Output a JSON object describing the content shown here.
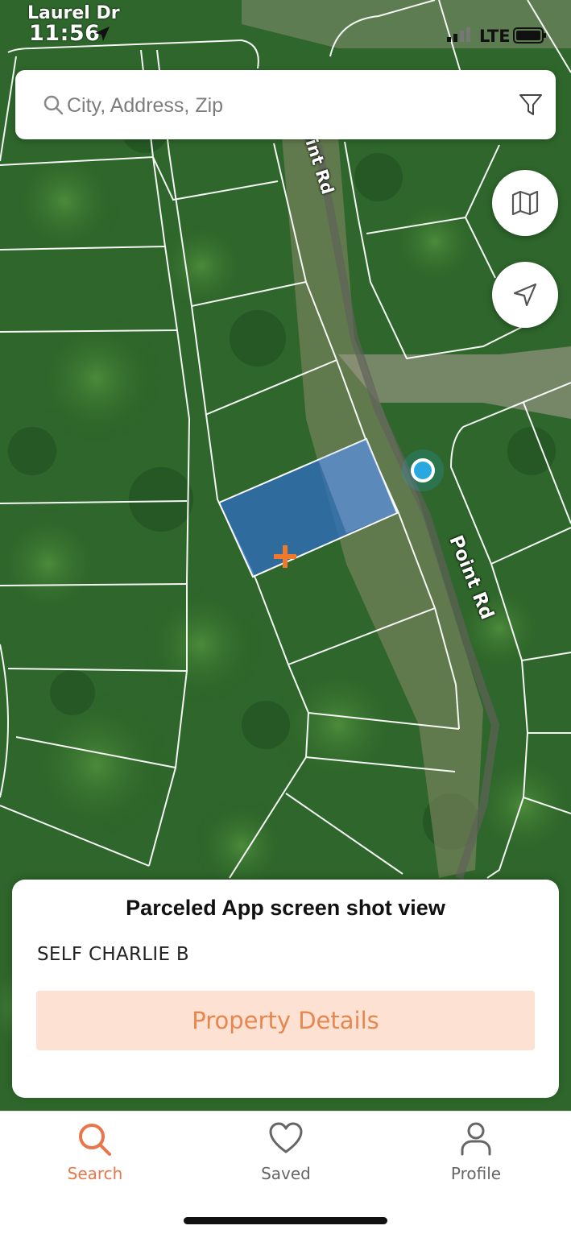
{
  "status_bar": {
    "location_label": "Laurel Dr",
    "time": "11:56",
    "network": "LTE"
  },
  "search": {
    "placeholder": "City, Address, Zip"
  },
  "map": {
    "road_labels": [
      "oint Rd",
      "Point Rd"
    ],
    "selected_parcel_color": "#2f6ebe",
    "marker_color": "#f07a2a",
    "user_location_color": "#29a8e0"
  },
  "card": {
    "title": "Parceled App screen shot view",
    "owner": "SELF CHARLIE B",
    "details_button": "Property Details"
  },
  "tabs": [
    {
      "label": "Search",
      "icon": "search-icon",
      "active": true
    },
    {
      "label": "Saved",
      "icon": "heart-icon",
      "active": false
    },
    {
      "label": "Profile",
      "icon": "person-icon",
      "active": false
    }
  ],
  "colors": {
    "accent": "#e8764a",
    "button_bg": "#fde2d3"
  }
}
